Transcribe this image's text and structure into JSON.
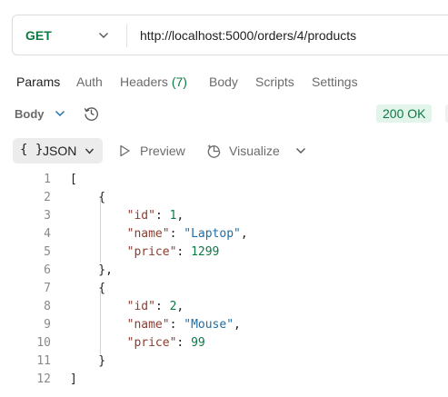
{
  "request": {
    "method": "GET",
    "url": "http://localhost:5000/orders/4/products"
  },
  "tabs": {
    "params": "Params",
    "auth": "Auth",
    "headers_label": "Headers",
    "headers_count": "(7)",
    "body": "Body",
    "scripts": "Scripts",
    "settings": "Settings"
  },
  "response": {
    "body_label": "Body",
    "status": "200 OK",
    "format_braces": "{ }",
    "format": "JSON",
    "preview": "Preview",
    "visualize": "Visualize"
  },
  "code_lines": [
    {
      "num": "1",
      "tokens": [
        {
          "t": "[",
          "c": "p"
        }
      ]
    },
    {
      "num": "2",
      "tokens": [
        {
          "t": "    {",
          "c": "p"
        }
      ]
    },
    {
      "num": "3",
      "tokens": [
        {
          "t": "        ",
          "c": "p"
        },
        {
          "t": "\"id\"",
          "c": "k"
        },
        {
          "t": ": ",
          "c": "p"
        },
        {
          "t": "1",
          "c": "n"
        },
        {
          "t": ",",
          "c": "p"
        }
      ]
    },
    {
      "num": "4",
      "tokens": [
        {
          "t": "        ",
          "c": "p"
        },
        {
          "t": "\"name\"",
          "c": "k"
        },
        {
          "t": ": ",
          "c": "p"
        },
        {
          "t": "\"Laptop\"",
          "c": "s"
        },
        {
          "t": ",",
          "c": "p"
        }
      ]
    },
    {
      "num": "5",
      "tokens": [
        {
          "t": "        ",
          "c": "p"
        },
        {
          "t": "\"price\"",
          "c": "k"
        },
        {
          "t": ": ",
          "c": "p"
        },
        {
          "t": "1299",
          "c": "n"
        }
      ]
    },
    {
      "num": "6",
      "tokens": [
        {
          "t": "    },",
          "c": "p"
        }
      ]
    },
    {
      "num": "7",
      "tokens": [
        {
          "t": "    {",
          "c": "p"
        }
      ]
    },
    {
      "num": "8",
      "tokens": [
        {
          "t": "        ",
          "c": "p"
        },
        {
          "t": "\"id\"",
          "c": "k"
        },
        {
          "t": ": ",
          "c": "p"
        },
        {
          "t": "2",
          "c": "n"
        },
        {
          "t": ",",
          "c": "p"
        }
      ]
    },
    {
      "num": "9",
      "tokens": [
        {
          "t": "        ",
          "c": "p"
        },
        {
          "t": "\"name\"",
          "c": "k"
        },
        {
          "t": ": ",
          "c": "p"
        },
        {
          "t": "\"Mouse\"",
          "c": "s"
        },
        {
          "t": ",",
          "c": "p"
        }
      ]
    },
    {
      "num": "10",
      "tokens": [
        {
          "t": "        ",
          "c": "p"
        },
        {
          "t": "\"price\"",
          "c": "k"
        },
        {
          "t": ": ",
          "c": "p"
        },
        {
          "t": "99",
          "c": "n"
        }
      ]
    },
    {
      "num": "11",
      "tokens": [
        {
          "t": "    }",
          "c": "p"
        }
      ]
    },
    {
      "num": "12",
      "tokens": [
        {
          "t": "]",
          "c": "p"
        }
      ]
    }
  ],
  "icons": {
    "method_dropdown": "chevron-down-icon",
    "body_dropdown": "chevron-down-icon",
    "history": "history-icon",
    "format_dropdown": "chevron-down-icon",
    "preview": "play-icon",
    "visualize": "visualize-icon",
    "more": "chevron-down-icon"
  },
  "colors": {
    "method": "#0c7a43",
    "status_bg": "#e3f5ea",
    "status_text": "#0c7a43",
    "json_key": "#8b3d2e",
    "json_string": "#1b6ea8",
    "json_number": "#0c7a43"
  }
}
